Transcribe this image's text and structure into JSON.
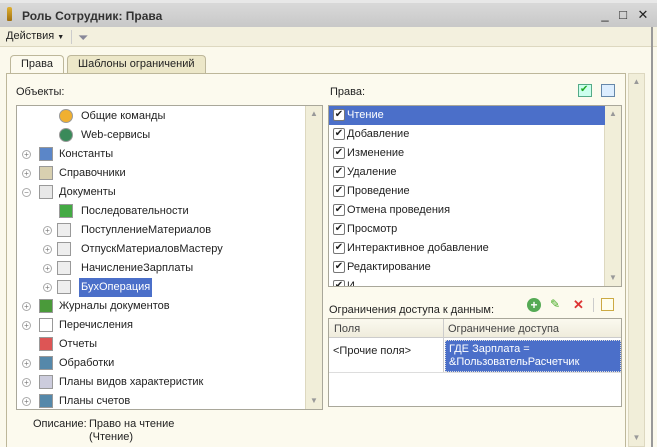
{
  "window": {
    "title": "Роль Сотрудник: Права",
    "minimize": "_",
    "maximize": "□",
    "close": "✕"
  },
  "toolbar": {
    "actions_label": "Действия",
    "filter_icon": "filter-icon"
  },
  "tabs": [
    {
      "label": "Права",
      "active": true
    },
    {
      "label": "Шаблоны ограничений",
      "active": false
    }
  ],
  "objects": {
    "label": "Объекты:",
    "items": [
      {
        "label": "Общие команды",
        "level": 1,
        "expander": "",
        "icon": "common-commands-icon"
      },
      {
        "label": "Web-сервисы",
        "level": 1,
        "expander": "",
        "icon": "web-services-icon"
      },
      {
        "label": "Константы",
        "level": 0,
        "expander": "+",
        "icon": "constants-icon"
      },
      {
        "label": "Справочники",
        "level": 0,
        "expander": "+",
        "icon": "catalogs-icon"
      },
      {
        "label": "Документы",
        "level": 0,
        "expander": "−",
        "icon": "documents-icon"
      },
      {
        "label": "Последовательности",
        "level": 1,
        "expander": "",
        "icon": "sequences-icon"
      },
      {
        "label": "ПоступлениеМатериалов",
        "level": 1,
        "expander": "+",
        "icon": "document-icon"
      },
      {
        "label": "ОтпускМатериаловМастеру",
        "level": 1,
        "expander": "+",
        "icon": "document-icon"
      },
      {
        "label": "НачислениеЗарплаты",
        "level": 1,
        "expander": "+",
        "icon": "document-icon"
      },
      {
        "label": "БухОперация",
        "level": 1,
        "expander": "+",
        "icon": "document-icon",
        "selected": true
      },
      {
        "label": "Журналы документов",
        "level": 0,
        "expander": "+",
        "icon": "journals-icon"
      },
      {
        "label": "Перечисления",
        "level": 0,
        "expander": "+",
        "icon": "enums-icon"
      },
      {
        "label": "Отчеты",
        "level": 0,
        "expander": "",
        "icon": "reports-icon"
      },
      {
        "label": "Обработки",
        "level": 0,
        "expander": "+",
        "icon": "data-processors-icon"
      },
      {
        "label": "Планы видов характеристик",
        "level": 0,
        "expander": "+",
        "icon": "chart-of-characteristics-icon"
      },
      {
        "label": "Планы счетов",
        "level": 0,
        "expander": "+",
        "icon": "chart-of-accounts-icon"
      }
    ]
  },
  "description": {
    "label": "Описание:",
    "line1": "Право на чтение",
    "line2": "(Чтение)"
  },
  "rights": {
    "label": "Права:",
    "items": [
      {
        "label": "Чтение",
        "checked": true,
        "selected": true
      },
      {
        "label": "Добавление",
        "checked": true
      },
      {
        "label": "Изменение",
        "checked": true
      },
      {
        "label": "Удаление",
        "checked": true
      },
      {
        "label": "Проведение",
        "checked": true
      },
      {
        "label": "Отмена проведения",
        "checked": true
      },
      {
        "label": "Просмотр",
        "checked": true
      },
      {
        "label": "Интерактивное добавление",
        "checked": true
      },
      {
        "label": "Редактирование",
        "checked": true
      },
      {
        "label": "И",
        "checked": true
      }
    ]
  },
  "restrictions": {
    "label": "Ограничения доступа к данным:",
    "columns": [
      "Поля",
      "Ограничение доступа"
    ],
    "rows": [
      {
        "field": "<Прочие поля>",
        "restriction_line1": "ГДЕ Зарплата =",
        "restriction_line2": "&ПользовательРасчетчик"
      }
    ]
  },
  "check": "✔"
}
